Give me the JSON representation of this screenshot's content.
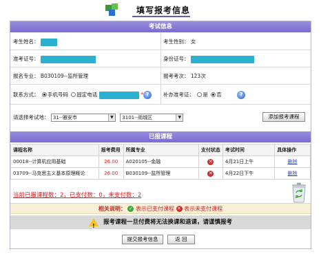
{
  "page_title": "填写报考信息",
  "exam_info": {
    "section_title": "考试信息",
    "name_label": "考生姓名：",
    "gender_label": "考生性别：",
    "gender_value": "女",
    "admission_no_label": "准考证号：",
    "id_no_label": "身份证号：",
    "major_label": "报名专业：",
    "major_value": "B030109--监所管理",
    "attempts_label": "报考考次：",
    "attempts_value": "123次",
    "contact_label": "联系方式：",
    "mobile_option": "手机号码",
    "landline_option": "固定电话",
    "required_mark": "*",
    "reissue_label": "补办准考证：",
    "yes_option": "是",
    "no_option": "否",
    "exam_location_label": "请选择考试地：",
    "city_select": "31--雅安市",
    "district_select": "3101--雨城区",
    "add_course_button": "添加报考课程"
  },
  "registered_courses": {
    "section_title": "已报课程",
    "headers": [
      "课程名称",
      "报考费用",
      "所属专业",
      "支付状态",
      "考试时间",
      "具体操作"
    ],
    "rows": [
      {
        "name": "00018--计算机应用基础",
        "fee": "26.00",
        "major": "A020105--金融",
        "status_icon": "unpaid-icon",
        "time": "4月21日上午",
        "action": "删除"
      },
      {
        "name": "03709--马克思主义基本原理概论",
        "fee": "26.00",
        "major": "B030109--监所管理",
        "status_icon": "unpaid-icon",
        "time": "4月22日下午",
        "action": "删除"
      }
    ],
    "summary": "当前已报课程数：2，已支付数：0，未支付数：2"
  },
  "legend": {
    "label": "相关说明：",
    "paid_text": "表示已支付课程",
    "unpaid_text": "表示未支付课程"
  },
  "warning": "报考课程一旦付费将无法换课和退课，请谨慎报考",
  "buttons": {
    "submit": "提交报考信息",
    "back": "返 回"
  },
  "colors": {
    "section_bar": "#8a7dd8",
    "alert_red": "#e02020",
    "masked_field": "#2bb0cf"
  }
}
